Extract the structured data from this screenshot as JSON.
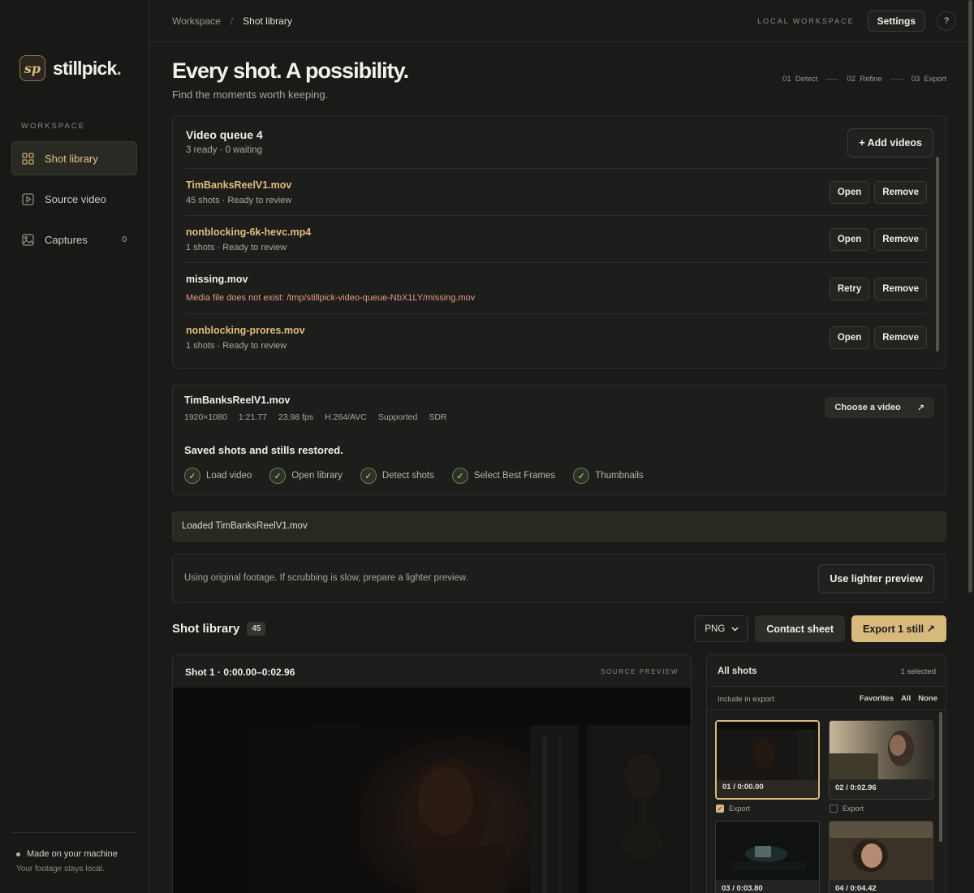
{
  "sidebar": {
    "brand_mark": "sp",
    "brand_name": "stillpick",
    "brand_dot": ".",
    "section_label": "WORKSPACE",
    "items": [
      {
        "label": "Shot library",
        "icon": "grid-icon",
        "active": true
      },
      {
        "label": "Source video",
        "icon": "play-square-icon",
        "active": false
      },
      {
        "label": "Captures",
        "icon": "image-icon",
        "active": false,
        "count": "0"
      }
    ],
    "footer_line1": "Made on your machine",
    "footer_line2": "Your footage stays local."
  },
  "topbar": {
    "breadcrumb": [
      "Workspace",
      "Shot library"
    ],
    "breadcrumb_sep": "/",
    "local_label": "LOCAL WORKSPACE",
    "settings_label": "Settings",
    "help_label": "?"
  },
  "hero": {
    "title": "Every shot. A possibility.",
    "subtitle": "Find the moments worth keeping.",
    "steps": [
      "01  Detect",
      "02  Refine",
      "03  Export"
    ]
  },
  "queue": {
    "title": "Video queue 4",
    "summary": "3 ready · 0 waiting",
    "add_label": "+ Add videos",
    "rows": [
      {
        "name": "TimBanksReelV1.mov",
        "meta": "45 shots · Ready to review",
        "primary": "Open",
        "secondary": "Remove",
        "status": "ready"
      },
      {
        "name": "nonblocking-6k-hevc.mp4",
        "meta": "1 shots · Ready to review",
        "primary": "Open",
        "secondary": "Remove",
        "status": "ready"
      },
      {
        "name": "missing.mov",
        "error": "Media file does not exist: /tmp/stillpick-video-queue-NbX1LY/missing.mov",
        "primary": "Retry",
        "secondary": "Remove",
        "status": "error"
      },
      {
        "name": "nonblocking-prores.mov",
        "meta": "1 shots · Ready to review",
        "primary": "Open",
        "secondary": "Remove",
        "status": "ready"
      }
    ]
  },
  "video": {
    "name": "TimBanksReelV1.mov",
    "specs": [
      "1920×1080",
      "1:21.77",
      "23.98 fps",
      "H.264/AVC",
      "Supported",
      "SDR"
    ],
    "choose_label": "Choose a video",
    "choose_arrow": "↗",
    "restored": "Saved shots and stills restored.",
    "pipeline": [
      "Load video",
      "Open library",
      "Detect shots",
      "Select Best Frames",
      "Thumbnails"
    ]
  },
  "status": {
    "loaded": "Loaded TimBanksReelV1.mov"
  },
  "notice": {
    "text": "Using original footage. If scrubbing is slow, prepare a lighter preview.",
    "button": "Use lighter preview"
  },
  "library": {
    "title": "Shot library",
    "count": "45",
    "format": "PNG",
    "format_options": [
      "PNG"
    ],
    "contact_label": "Contact sheet",
    "export_label": "Export 1 still ↗"
  },
  "preview": {
    "title": "Shot 1 · 0:00.00–0:02.96",
    "tag": "SOURCE PREVIEW"
  },
  "shots": {
    "title": "All shots",
    "selected": "1 selected",
    "include_label": "Include in export",
    "links": [
      "Favorites",
      "All",
      "None"
    ],
    "export_label": "Export",
    "tiles": [
      {
        "label": "01 / 0:00.00",
        "selected": true,
        "export": true
      },
      {
        "label": "02 / 0:02.96",
        "selected": false,
        "export": false
      },
      {
        "label": "03 / 0:03.80",
        "selected": false,
        "export": false
      },
      {
        "label": "04 / 0:04.42",
        "selected": false,
        "export": false
      }
    ]
  },
  "colors": {
    "accent": "#d8b97c",
    "background": "#1a1a19",
    "error": "#e59a88",
    "success_bar": "#272a21"
  }
}
